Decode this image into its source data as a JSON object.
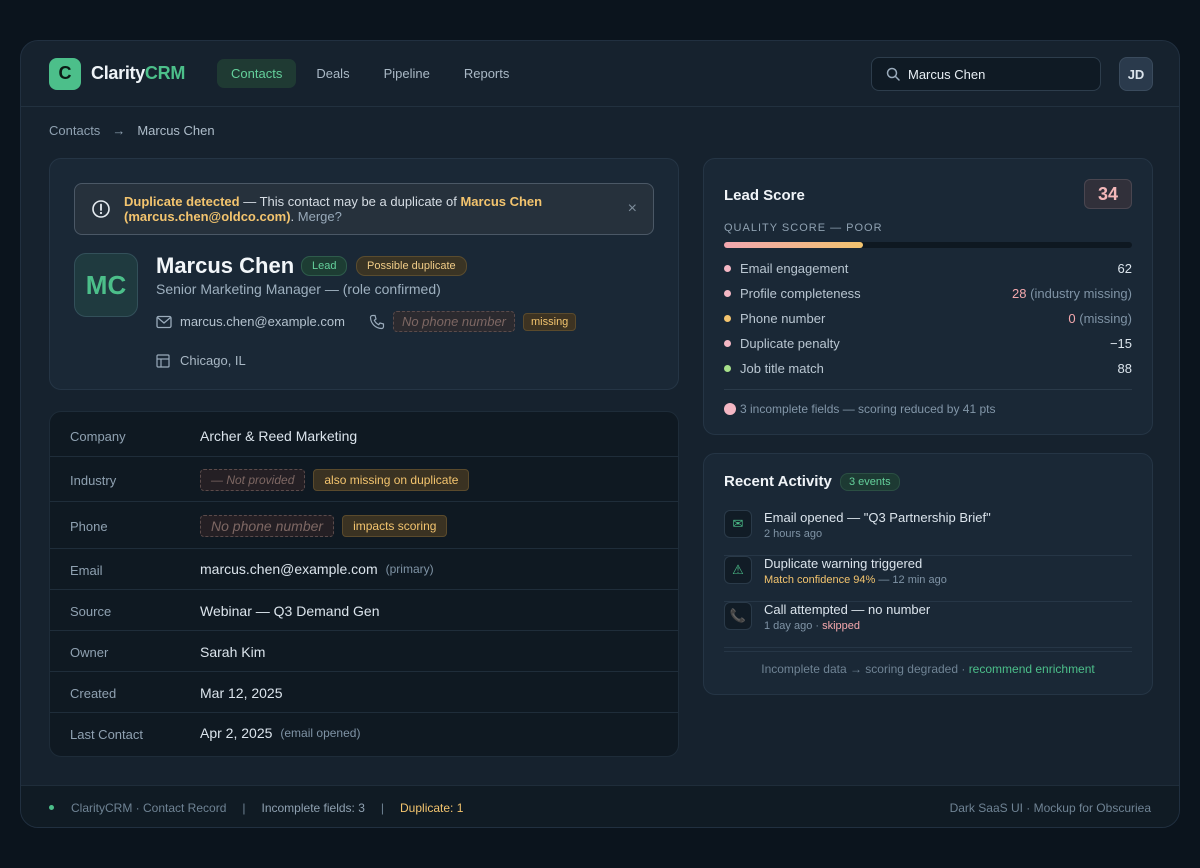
{
  "app": {
    "logo_letter": "C",
    "logo_name": "Clarity",
    "logo_accent": "CRM"
  },
  "nav": [
    "Contacts",
    "Deals",
    "Pipeline",
    "Reports"
  ],
  "search": {
    "value": "Marcus Chen"
  },
  "user": {
    "initials": "JD"
  },
  "breadcrumb": {
    "root": "Contacts",
    "sep": "→",
    "current": "Marcus Chen"
  },
  "alert": {
    "strong": "Duplicate detected",
    "mid": " — This contact may be a duplicate of ",
    "target": "Marcus Chen (marcus.chen@oldco.com)",
    "tail": ".",
    "merge": "Merge?",
    "close": "×"
  },
  "profile": {
    "initials": "MC",
    "name": "Marcus Chen",
    "badge_lead": "Lead",
    "badge_dup": "Possible duplicate",
    "role": "Senior Marketing Manager — (role confirmed)",
    "email": "marcus.chen@example.com",
    "phone_placeholder": "No phone number",
    "phone_tag": "missing",
    "location": "Chicago, IL"
  },
  "details": {
    "company": {
      "label": "Company",
      "value": "Archer & Reed Marketing"
    },
    "industry": {
      "label": "Industry",
      "missing": "— Not provided",
      "tag": "also missing on duplicate"
    },
    "phone": {
      "label": "Phone",
      "missing": "No phone number",
      "tag": "impacts scoring"
    },
    "email": {
      "label": "Email",
      "value": "marcus.chen@example.com",
      "sub": "(primary)"
    },
    "source": {
      "label": "Source",
      "value": "Webinar — Q3 Demand Gen"
    },
    "owner": {
      "label": "Owner",
      "value": "Sarah Kim"
    },
    "created": {
      "label": "Created",
      "value": "Mar 12, 2025"
    },
    "last_contact": {
      "label": "Last Contact",
      "value": "Apr 2, 2025",
      "sub": "(email opened)"
    }
  },
  "lead_score": {
    "title": "Lead Score",
    "score": "34",
    "quality_label": "QUALITY SCORE — POOR",
    "quality_fraction": 0.34,
    "factors": [
      {
        "name": "Email engagement",
        "value": "62",
        "note": "",
        "color": "#f4b7c4"
      },
      {
        "name": "Profile completeness",
        "value": "28",
        "note": "(industry missing)",
        "color": "#f4b7c4"
      },
      {
        "name": "Phone number",
        "value": "0",
        "note": "(missing)",
        "color": "#f3c46e"
      },
      {
        "name": "Duplicate penalty",
        "value": "−15",
        "note": "",
        "color": "#f4b7c4"
      },
      {
        "name": "Job title match",
        "value": "88",
        "note": "",
        "color": "#a7e08a"
      }
    ],
    "footer": "3 incomplete fields — scoring reduced by 41 pts"
  },
  "activity": {
    "title": "Recent Activity",
    "badge": "3 events",
    "items": [
      {
        "title": "Email opened — \"Q3 Partnership Brief\"",
        "sub": "2 hours ago",
        "icon": "envelope-icon"
      },
      {
        "title": "Duplicate warning triggered",
        "sub_highlight": "Match confidence 94%",
        "sub": " — 12 min ago",
        "icon": "warning-icon"
      },
      {
        "title": "Call attempted — no number",
        "sub": "1 day ago · ",
        "sub_highlight": "skipped",
        "icon": "phone-icon"
      }
    ],
    "footer_text": "Incomplete data → scoring degraded · ",
    "footer_link": "recommend enrichment"
  },
  "footer": {
    "left": "ClarityCRM · Contact Record",
    "sep": "|",
    "incomplete": "Incomplete fields: 3",
    "duplicate": "Duplicate: 1",
    "right": "Dark SaaS UI · Mockup for Obscuriea"
  },
  "colors": {
    "accent": "#4cbf8a",
    "warning": "#f3c46e",
    "danger": "#f4a8ad",
    "background": "#0b141d"
  }
}
